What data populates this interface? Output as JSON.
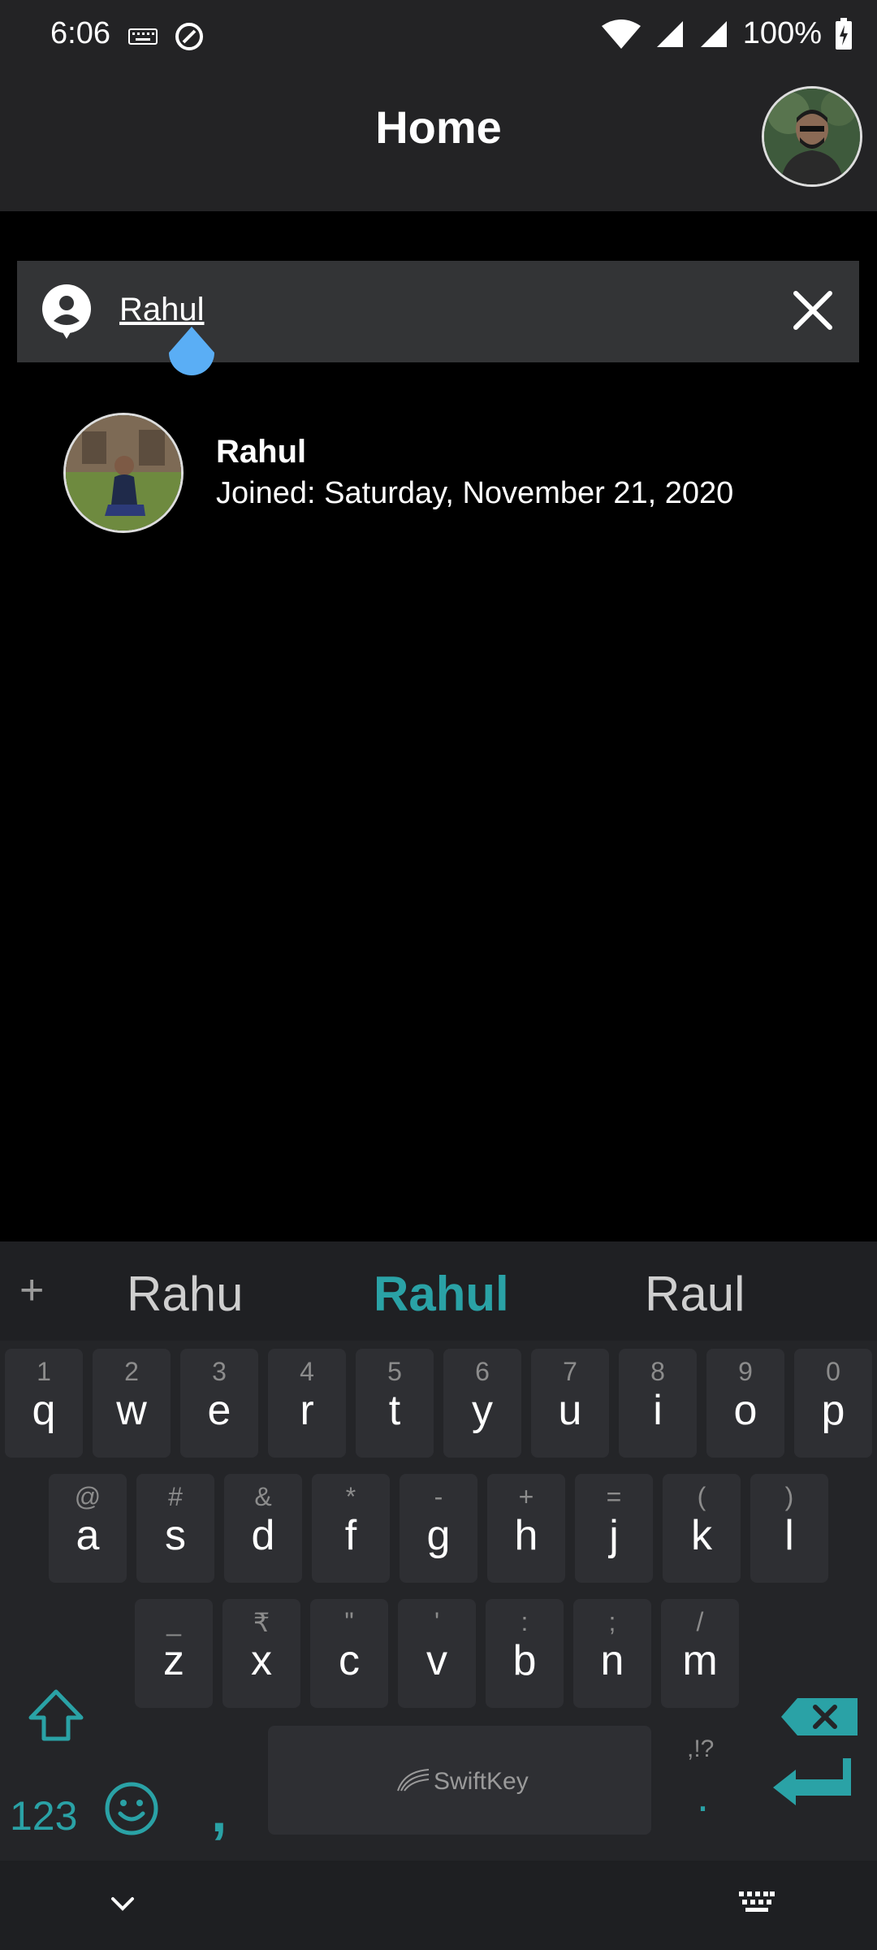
{
  "status_bar": {
    "time": "6:06",
    "battery": "100%"
  },
  "app_bar": {
    "title": "Home"
  },
  "search": {
    "value": "Rahul"
  },
  "results": [
    {
      "name": "Rahul",
      "subtitle": "Joined: Saturday, November 21, 2020"
    }
  ],
  "keyboard": {
    "suggestions": [
      "Rahu",
      "Rahul",
      "Raul"
    ],
    "row1": [
      {
        "hint": "1",
        "key": "q"
      },
      {
        "hint": "2",
        "key": "w"
      },
      {
        "hint": "3",
        "key": "e"
      },
      {
        "hint": "4",
        "key": "r"
      },
      {
        "hint": "5",
        "key": "t"
      },
      {
        "hint": "6",
        "key": "y"
      },
      {
        "hint": "7",
        "key": "u"
      },
      {
        "hint": "8",
        "key": "i"
      },
      {
        "hint": "9",
        "key": "o"
      },
      {
        "hint": "0",
        "key": "p"
      }
    ],
    "row2": [
      {
        "hint": "@",
        "key": "a"
      },
      {
        "hint": "#",
        "key": "s"
      },
      {
        "hint": "&",
        "key": "d"
      },
      {
        "hint": "*",
        "key": "f"
      },
      {
        "hint": "-",
        "key": "g"
      },
      {
        "hint": "+",
        "key": "h"
      },
      {
        "hint": "=",
        "key": "j"
      },
      {
        "hint": "(",
        "key": "k"
      },
      {
        "hint": ")",
        "key": "l"
      }
    ],
    "row3": [
      {
        "hint": "_",
        "key": "z"
      },
      {
        "hint": "₹",
        "key": "x"
      },
      {
        "hint": "\"",
        "key": "c"
      },
      {
        "hint": "'",
        "key": "v"
      },
      {
        "hint": ":",
        "key": "b"
      },
      {
        "hint": ";",
        "key": "n"
      },
      {
        "hint": "/",
        "key": "m"
      }
    ],
    "numbers_label": "123",
    "comma": ",",
    "space_label": "SwiftKey",
    "punct_hint": ",!?",
    "period": ".",
    "accent_color": "#2aa2a6"
  }
}
